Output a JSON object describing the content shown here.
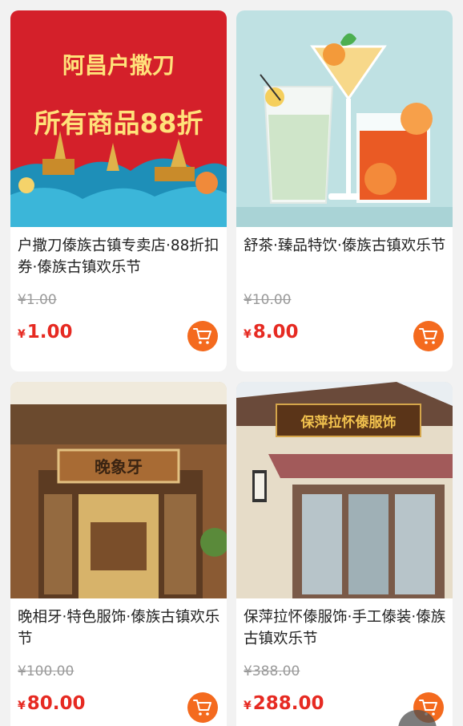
{
  "products": [
    {
      "title": "户撒刀傣族古镇专卖店·88折扣券·傣族古镇欢乐节",
      "original_price": "¥1.00",
      "currency": "¥",
      "price": "1.00",
      "image": {
        "line1": "阿昌户撒刀",
        "line2": "所有商品88折"
      }
    },
    {
      "title": "舒茶·臻品特饮·傣族古镇欢乐节",
      "original_price": "¥10.00",
      "currency": "¥",
      "price": "8.00",
      "image": {}
    },
    {
      "title": "晚相牙·特色服饰·傣族古镇欢乐节",
      "original_price": "¥100.00",
      "currency": "¥",
      "price": "80.00",
      "image": {
        "sign": "晚象牙"
      }
    },
    {
      "title": "保萍拉怀傣服饰·手工傣装·傣族古镇欢乐节",
      "original_price": "¥388.00",
      "currency": "¥",
      "price": "288.00",
      "image": {
        "sign": "保萍拉怀傣服饰"
      }
    }
  ],
  "colors": {
    "price": "#e62a22",
    "cart_button": "#f46a1e",
    "promo_red": "#d4202a",
    "promo_yellow": "#ffe27a"
  }
}
